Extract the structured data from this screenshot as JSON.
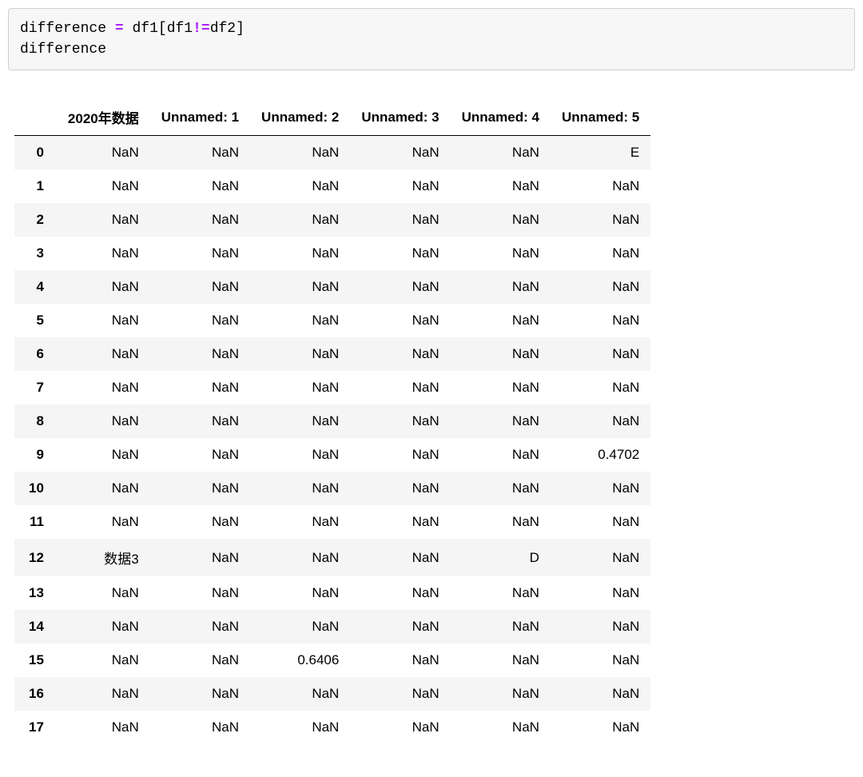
{
  "code": {
    "line1_lhs": "difference",
    "line1_eq": "=",
    "line1_df1a": "df1",
    "line1_lb": "[",
    "line1_df1b": "df1",
    "line1_neq": "!=",
    "line1_df2": "df2",
    "line1_rb": "]",
    "line2": "difference"
  },
  "table": {
    "columns": [
      "2020年数据",
      "Unnamed: 1",
      "Unnamed: 2",
      "Unnamed: 3",
      "Unnamed: 4",
      "Unnamed: 5"
    ],
    "index": [
      "0",
      "1",
      "2",
      "3",
      "4",
      "5",
      "6",
      "7",
      "8",
      "9",
      "10",
      "11",
      "12",
      "13",
      "14",
      "15",
      "16",
      "17"
    ],
    "rows": [
      [
        "NaN",
        "NaN",
        "NaN",
        "NaN",
        "NaN",
        "E"
      ],
      [
        "NaN",
        "NaN",
        "NaN",
        "NaN",
        "NaN",
        "NaN"
      ],
      [
        "NaN",
        "NaN",
        "NaN",
        "NaN",
        "NaN",
        "NaN"
      ],
      [
        "NaN",
        "NaN",
        "NaN",
        "NaN",
        "NaN",
        "NaN"
      ],
      [
        "NaN",
        "NaN",
        "NaN",
        "NaN",
        "NaN",
        "NaN"
      ],
      [
        "NaN",
        "NaN",
        "NaN",
        "NaN",
        "NaN",
        "NaN"
      ],
      [
        "NaN",
        "NaN",
        "NaN",
        "NaN",
        "NaN",
        "NaN"
      ],
      [
        "NaN",
        "NaN",
        "NaN",
        "NaN",
        "NaN",
        "NaN"
      ],
      [
        "NaN",
        "NaN",
        "NaN",
        "NaN",
        "NaN",
        "NaN"
      ],
      [
        "NaN",
        "NaN",
        "NaN",
        "NaN",
        "NaN",
        "0.4702"
      ],
      [
        "NaN",
        "NaN",
        "NaN",
        "NaN",
        "NaN",
        "NaN"
      ],
      [
        "NaN",
        "NaN",
        "NaN",
        "NaN",
        "NaN",
        "NaN"
      ],
      [
        "数据3",
        "NaN",
        "NaN",
        "NaN",
        "D",
        "NaN"
      ],
      [
        "NaN",
        "NaN",
        "NaN",
        "NaN",
        "NaN",
        "NaN"
      ],
      [
        "NaN",
        "NaN",
        "NaN",
        "NaN",
        "NaN",
        "NaN"
      ],
      [
        "NaN",
        "NaN",
        "0.6406",
        "NaN",
        "NaN",
        "NaN"
      ],
      [
        "NaN",
        "NaN",
        "NaN",
        "NaN",
        "NaN",
        "NaN"
      ],
      [
        "NaN",
        "NaN",
        "NaN",
        "NaN",
        "NaN",
        "NaN"
      ]
    ]
  }
}
